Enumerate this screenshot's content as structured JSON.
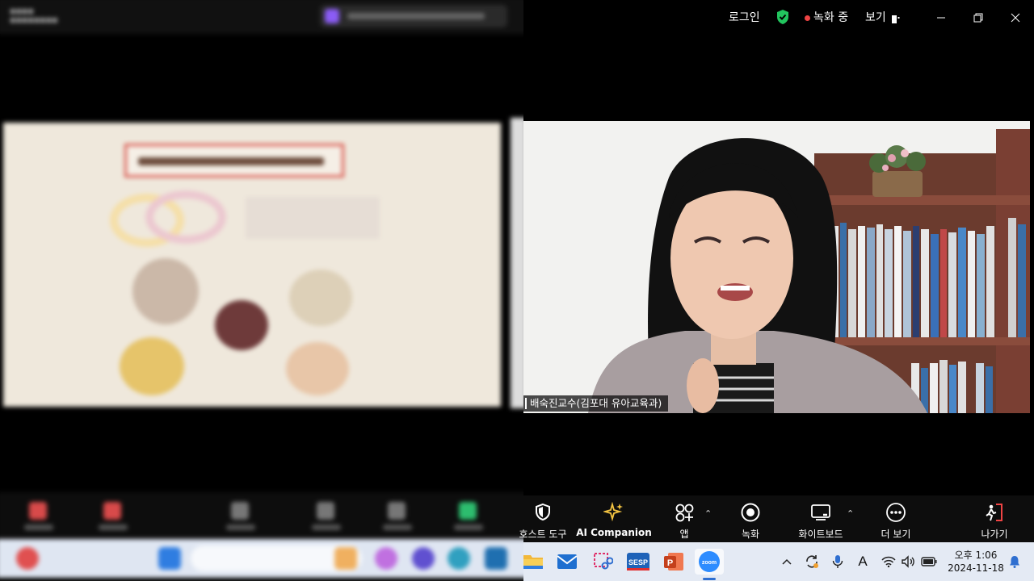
{
  "titlebar": {
    "login": "로그인",
    "recording": "녹화 중",
    "view": "보기",
    "colors": {
      "shield": "#22c55e",
      "rec_dot": "#ef4444"
    }
  },
  "video": {
    "participant_name": "배숙진교수(김포대 유아교육과)"
  },
  "toolbar": {
    "items": [
      {
        "label": "호스트 도구",
        "icon": "shield-icon"
      },
      {
        "label": "AI Companion",
        "icon": "sparkle-icon"
      },
      {
        "label": "앱",
        "icon": "apps-icon"
      },
      {
        "label": "녹화",
        "icon": "record-icon"
      },
      {
        "label": "화이트보드",
        "icon": "whiteboard-icon"
      },
      {
        "label": "더 보기",
        "icon": "more-icon"
      },
      {
        "label": "나가기",
        "icon": "leave-icon"
      }
    ],
    "colors": {
      "ai_sparkle": "#f5c542",
      "leave": "#ef4444"
    }
  },
  "taskbar": {
    "apps": [
      "file-explorer-icon",
      "mail-icon",
      "snipping-tool-icon",
      "SESP",
      "P",
      "zoom"
    ],
    "clock": {
      "time": "오후 1:06",
      "date": "2024-11-18"
    },
    "ime": "A"
  }
}
